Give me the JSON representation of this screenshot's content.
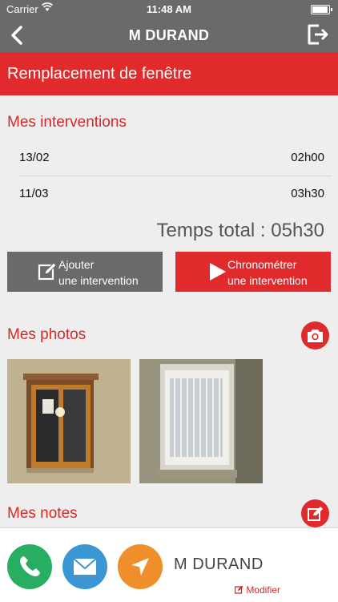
{
  "status_bar": {
    "carrier": "Carrier",
    "time": "11:48 AM"
  },
  "nav": {
    "title": "M DURAND",
    "back_icon": "chevron-left-icon",
    "export_icon": "export-icon"
  },
  "job": {
    "title": "Remplacement de fenêtre"
  },
  "interventions": {
    "title": "Mes interventions",
    "rows": [
      {
        "date": "13/02",
        "duration": "02h00"
      },
      {
        "date": "11/03",
        "duration": "03h30"
      }
    ],
    "total": "Temps total : 05h30"
  },
  "actions": {
    "add_line1": "Ajouter",
    "add_line2": "une intervention",
    "chrono_line1": "Chronométrer",
    "chrono_line2": "une intervention"
  },
  "photos": {
    "title": "Mes photos",
    "camera_icon": "camera-icon"
  },
  "notes": {
    "title": "Mes notes",
    "edit_icon": "edit-icon"
  },
  "contact": {
    "name": "M DURAND",
    "modify_label": "Modifier",
    "phone_color": "#27ae60",
    "mail_color": "#3a97d4",
    "nav_color": "#ef8f2b"
  },
  "colors": {
    "accent": "#e02a2b",
    "header_gray": "#6a6a6a",
    "background": "#efeeee"
  }
}
